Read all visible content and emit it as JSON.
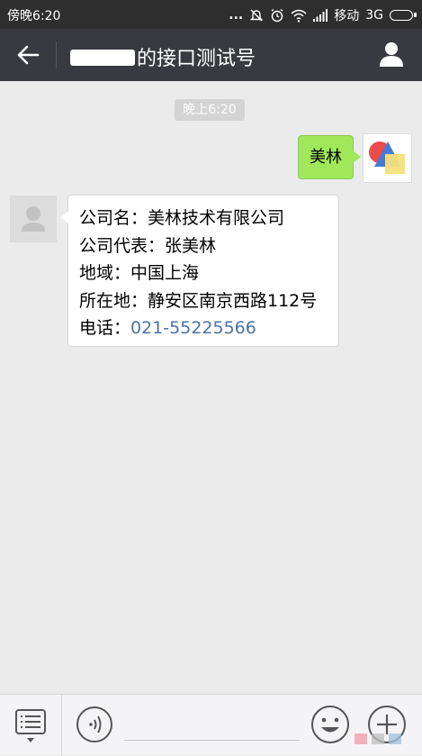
{
  "status_bar": {
    "time": "傍晚6:20",
    "dots": "...",
    "carrier": "移动",
    "network": "3G"
  },
  "header": {
    "title": "的接口测试号"
  },
  "chat": {
    "timestamp": "晚上6:20",
    "messages": [
      {
        "from": "me",
        "text": "美林"
      },
      {
        "from": "other",
        "lines": [
          "公司名：美林技术有限公司",
          "公司代表：张美林",
          "地域：中国上海",
          "所在地：静安区南京西路112号"
        ],
        "phone_label": "电话：",
        "phone": "021-55225566"
      }
    ]
  },
  "colors": {
    "header_bg": "#393a3f",
    "my_bubble": "#a0e75a",
    "link": "#4a72a6",
    "chat_bg": "#ebebeb"
  },
  "icons": [
    "back-arrow-icon",
    "contact-profile-icon",
    "keyboard-menu-icon",
    "voice-icon",
    "emoji-icon",
    "plus-icon"
  ]
}
